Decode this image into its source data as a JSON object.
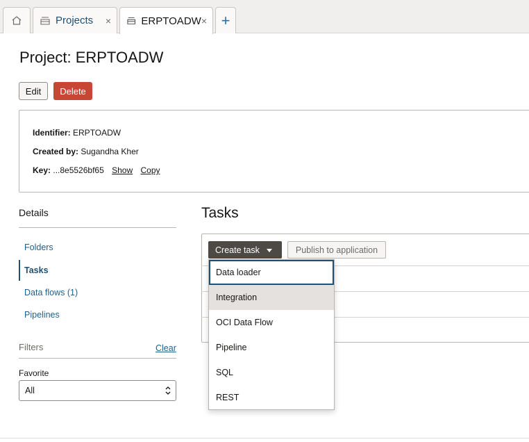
{
  "tabs": {
    "home_icon": "home-icon",
    "projects_label": "Projects",
    "erp_label": "ERPTOADW",
    "close_glyph": "×",
    "add_glyph": "+"
  },
  "page": {
    "title": "Project: ERPTOADW",
    "edit_label": "Edit",
    "delete_label": "Delete"
  },
  "info": {
    "identifier_label": "Identifier:",
    "identifier_value": "ERPTOADW",
    "created_by_label": "Created by:",
    "created_by_value": "Sugandha Kher",
    "key_label": "Key:",
    "key_value": "...8e5526bf65",
    "show_label": "Show",
    "copy_label": "Copy"
  },
  "nav": {
    "heading": "Details",
    "items": [
      {
        "label": "Folders"
      },
      {
        "label": "Tasks"
      },
      {
        "label": "Data flows (1)"
      },
      {
        "label": "Pipelines"
      }
    ],
    "selected": "Tasks"
  },
  "filters": {
    "label": "Filters",
    "clear_label": "Clear",
    "favorite_label": "Favorite",
    "favorite_value": "All"
  },
  "tasks": {
    "title": "Tasks",
    "create_label": "Create task",
    "publish_label": "Publish to application",
    "menu": [
      {
        "label": "Data loader"
      },
      {
        "label": "Integration"
      },
      {
        "label": "OCI Data Flow"
      },
      {
        "label": "Pipeline"
      },
      {
        "label": "SQL"
      },
      {
        "label": "REST"
      }
    ]
  },
  "colors": {
    "accent": "#1f4f73",
    "link": "#1f5f8c",
    "danger": "#c74634",
    "create_button": "#4d4a46"
  }
}
